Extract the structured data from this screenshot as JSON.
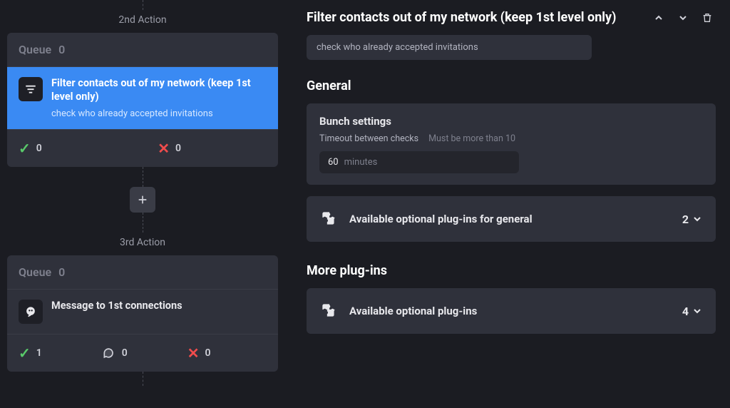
{
  "left": {
    "actions": [
      {
        "label": "2nd Action",
        "queue_label": "Queue",
        "queue_count": "0",
        "entry": {
          "title": "Filter contacts out of my network (keep 1st level only)",
          "subtitle": "check who already accepted invitations",
          "selected": true
        },
        "stats": {
          "success": "0",
          "fail": "0"
        }
      },
      {
        "label": "3rd Action",
        "queue_label": "Queue",
        "queue_count": "0",
        "entry": {
          "title": "Message to 1st connections",
          "selected": false
        },
        "stats": {
          "success": "1",
          "chat": "0",
          "fail": "0"
        }
      }
    ]
  },
  "right": {
    "title": "Filter contacts out of my network (keep 1st level only)",
    "description": "check who already accepted invitations",
    "general": {
      "heading": "General",
      "bunch": {
        "title": "Bunch settings",
        "timeout_label": "Timeout between checks",
        "timeout_hint": "Must be more than 10",
        "timeout_value": "60",
        "timeout_unit": "minutes"
      },
      "plugins": {
        "label": "Available optional plug-ins for general",
        "count": "2"
      }
    },
    "more": {
      "heading": "More plug-ins",
      "plugins": {
        "label": "Available optional plug-ins",
        "count": "4"
      }
    }
  }
}
